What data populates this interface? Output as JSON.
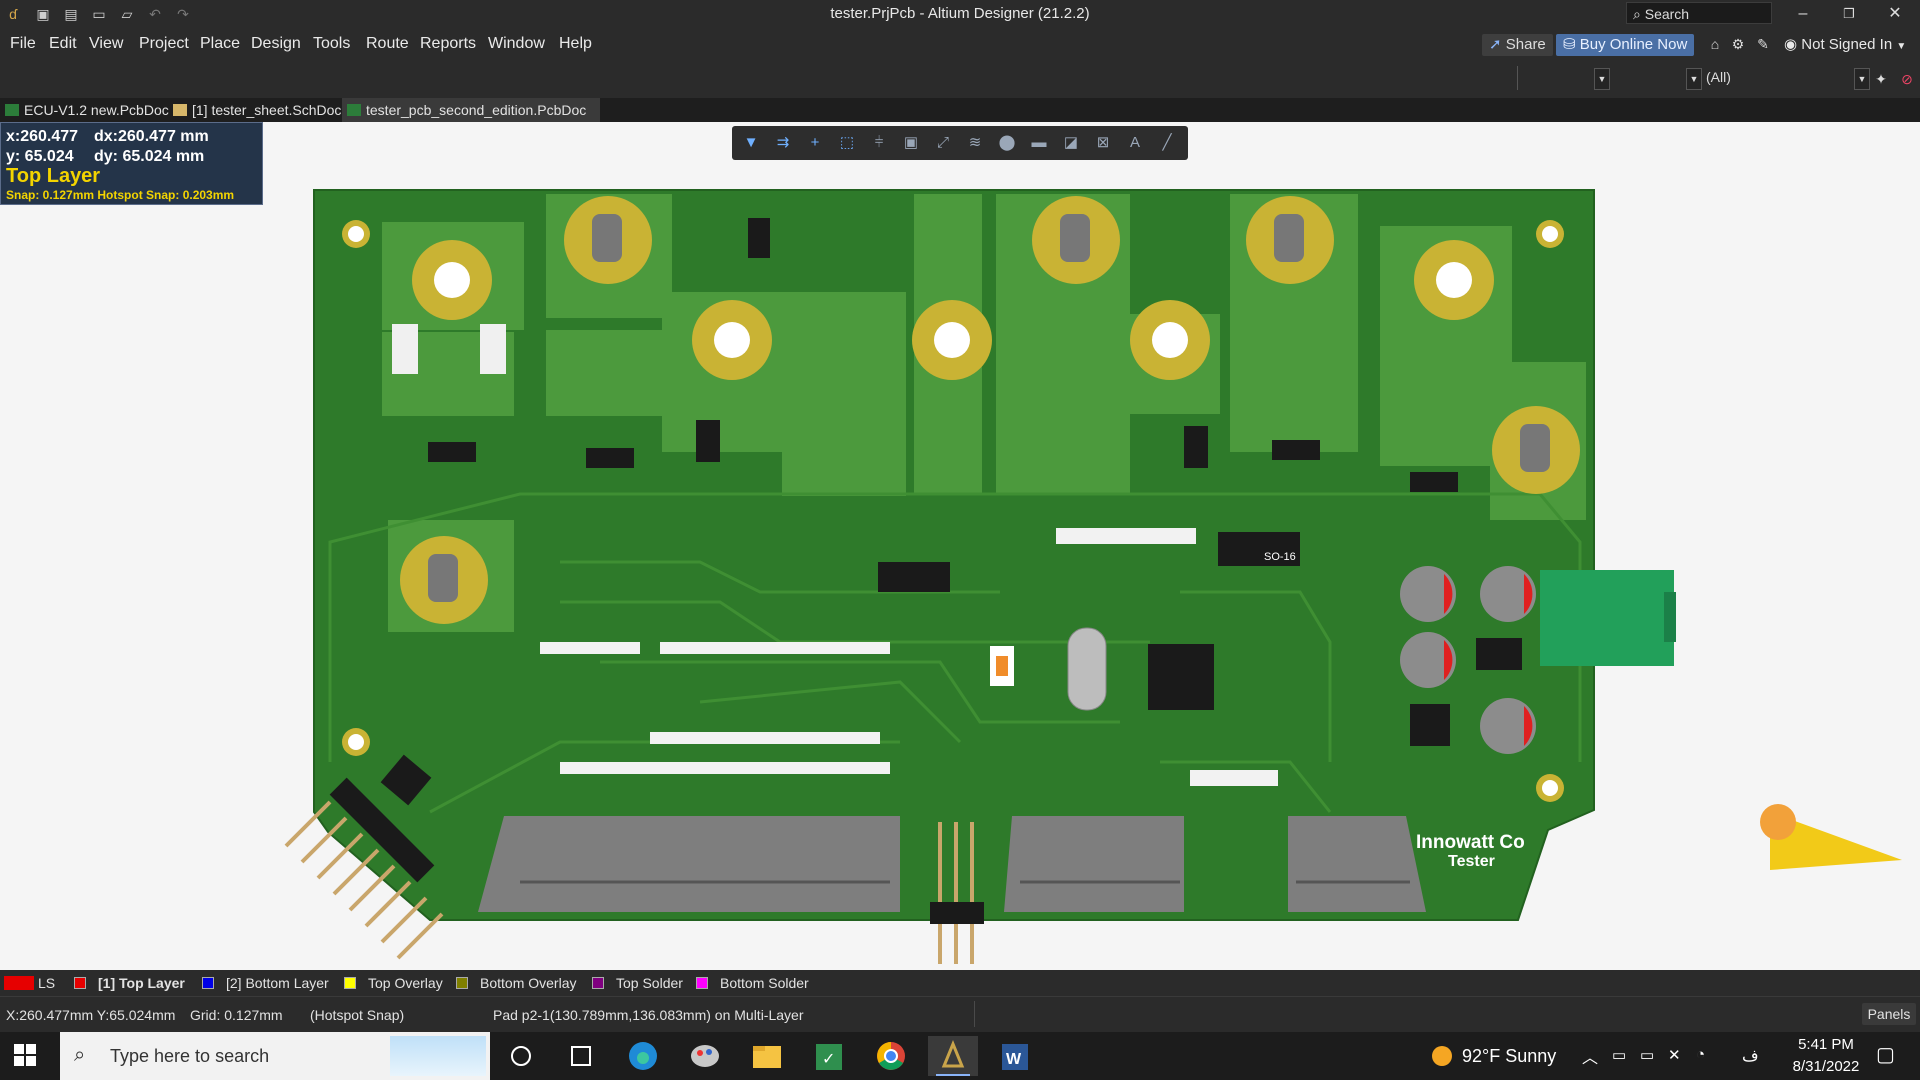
{
  "window": {
    "title": "tester.PrjPcb - Altium Designer (21.2.2)",
    "search_label": "Search"
  },
  "menu": [
    "File",
    "Edit",
    "View",
    "Project",
    "Place",
    "Design",
    "Tools",
    "Route",
    "Reports",
    "Window",
    "Help"
  ],
  "header_buttons": {
    "share": "Share",
    "buy": "Buy Online Now",
    "account": "Not Signed In"
  },
  "filter": {
    "value": "(All)"
  },
  "tabs": [
    {
      "label": "ECU-V1.2 new.PcbDoc",
      "kind": "pcb"
    },
    {
      "label": "[1] tester_sheet.SchDoc",
      "kind": "sch"
    },
    {
      "label": "tester_pcb_second_edition.PcbDoc",
      "kind": "pcb",
      "active": true
    }
  ],
  "coords": {
    "x": "x:260.477",
    "dx": "dx:260.477 mm",
    "y": "y: 65.024",
    "dy": "dy: 65.024  mm",
    "layer": "Top Layer",
    "snap": "Snap: 0.127mm Hotspot Snap: 0.203mm"
  },
  "board": {
    "silk_title": "Innowatt Co",
    "silk_subtitle": "Tester",
    "ic_label": "SO-16",
    "colors": {
      "board": "#2e7a2a",
      "copper": "#4c9a3d",
      "pad": "#c9b334",
      "bg": "#f5f5f5"
    }
  },
  "layers": [
    {
      "label": "LS",
      "color": "#e60000"
    },
    {
      "label": "[1] Top Layer",
      "color": "#e60000",
      "active": true
    },
    {
      "label": "[2] Bottom Layer",
      "color": "#0000e6"
    },
    {
      "label": "Top Overlay",
      "color": "#ffff00"
    },
    {
      "label": "Bottom Overlay",
      "color": "#808000"
    },
    {
      "label": "Top Solder",
      "color": "#800080"
    },
    {
      "label": "Bottom Solder",
      "color": "#ff00ff"
    }
  ],
  "status": {
    "coords": "X:260.477mm Y:65.024mm",
    "grid": "Grid: 0.127mm",
    "snap": "(Hotspot Snap)",
    "pad": "Pad p2-1(130.789mm,136.083mm) on Multi-Layer",
    "panels": "Panels"
  },
  "taskbar": {
    "search_placeholder": "Type here to search",
    "weather": "92°F  Sunny",
    "time": "5:41 PM",
    "date": "8/31/2022",
    "lang": "ف"
  }
}
